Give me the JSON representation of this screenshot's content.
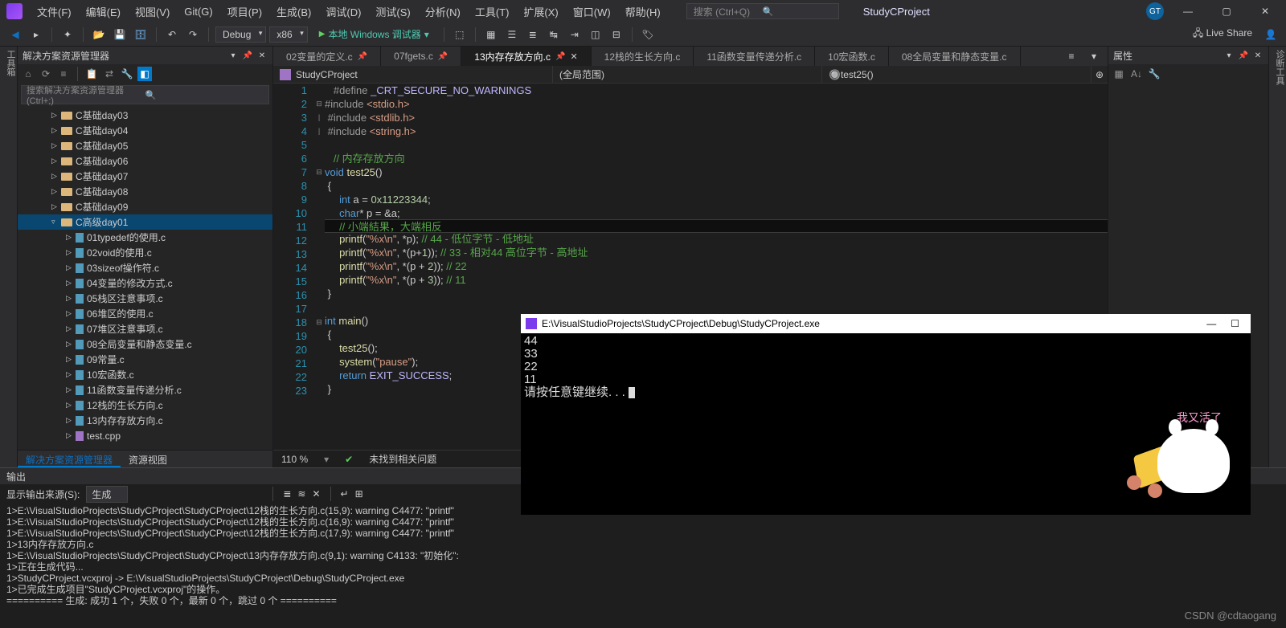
{
  "menubar": {
    "items": [
      "文件(F)",
      "编辑(E)",
      "视图(V)",
      "Git(G)",
      "项目(P)",
      "生成(B)",
      "调试(D)",
      "测试(S)",
      "分析(N)",
      "工具(T)",
      "扩展(X)",
      "窗口(W)",
      "帮助(H)"
    ],
    "search_placeholder": "搜索 (Ctrl+Q)",
    "project": "StudyCProject",
    "avatar": "GT"
  },
  "toolbar": {
    "config": "Debug",
    "platform": "x86",
    "run_label": "本地 Windows 调试器",
    "liveshare": "Live Share"
  },
  "solution": {
    "title": "解决方案资源管理器",
    "search_placeholder": "搜索解决方案资源管理器(Ctrl+;)",
    "tree": [
      {
        "indent": 2,
        "arrow": "▷",
        "icon": "folder",
        "label": "C基础day03"
      },
      {
        "indent": 2,
        "arrow": "▷",
        "icon": "folder",
        "label": "C基础day04"
      },
      {
        "indent": 2,
        "arrow": "▷",
        "icon": "folder",
        "label": "C基础day05"
      },
      {
        "indent": 2,
        "arrow": "▷",
        "icon": "folder",
        "label": "C基础day06"
      },
      {
        "indent": 2,
        "arrow": "▷",
        "icon": "folder",
        "label": "C基础day07"
      },
      {
        "indent": 2,
        "arrow": "▷",
        "icon": "folder",
        "label": "C基础day08"
      },
      {
        "indent": 2,
        "arrow": "▷",
        "icon": "folder",
        "label": "C基础day09"
      },
      {
        "indent": 2,
        "arrow": "▿",
        "icon": "folder",
        "label": "C高级day01",
        "selected": true
      },
      {
        "indent": 3,
        "arrow": "▷",
        "icon": "file",
        "label": "01typedef的使用.c"
      },
      {
        "indent": 3,
        "arrow": "▷",
        "icon": "file",
        "label": "02void的使用.c"
      },
      {
        "indent": 3,
        "arrow": "▷",
        "icon": "file",
        "label": "03sizeof操作符.c"
      },
      {
        "indent": 3,
        "arrow": "▷",
        "icon": "file",
        "label": "04变量的修改方式.c"
      },
      {
        "indent": 3,
        "arrow": "▷",
        "icon": "file",
        "label": "05栈区注意事项.c"
      },
      {
        "indent": 3,
        "arrow": "▷",
        "icon": "file",
        "label": "06堆区的使用.c"
      },
      {
        "indent": 3,
        "arrow": "▷",
        "icon": "file",
        "label": "07堆区注意事项.c"
      },
      {
        "indent": 3,
        "arrow": "▷",
        "icon": "file",
        "label": "08全局变量和静态变量.c"
      },
      {
        "indent": 3,
        "arrow": "▷",
        "icon": "file",
        "label": "09常量.c"
      },
      {
        "indent": 3,
        "arrow": "▷",
        "icon": "file",
        "label": "10宏函数.c"
      },
      {
        "indent": 3,
        "arrow": "▷",
        "icon": "file",
        "label": "11函数变量传递分析.c"
      },
      {
        "indent": 3,
        "arrow": "▷",
        "icon": "file",
        "label": "12栈的生长方向.c"
      },
      {
        "indent": 3,
        "arrow": "▷",
        "icon": "file",
        "label": "13内存存放方向.c"
      },
      {
        "indent": 3,
        "arrow": "▷",
        "icon": "cpp",
        "label": "test.cpp"
      }
    ],
    "bottom_tabs": [
      "解决方案资源管理器",
      "资源视图"
    ]
  },
  "editor": {
    "tabs": [
      {
        "label": "02变量的定义.c",
        "pin": true
      },
      {
        "label": "07fgets.c",
        "pin": true
      },
      {
        "label": "13内存存放方向.c",
        "pin": true,
        "active": true,
        "close": true
      },
      {
        "label": "12栈的生长方向.c"
      },
      {
        "label": "11函数变量传递分析.c"
      },
      {
        "label": "10宏函数.c"
      },
      {
        "label": "08全局变量和静态变量.c"
      }
    ],
    "nav": {
      "project": "StudyCProject",
      "scope": "(全局范围)",
      "member": "test25()"
    },
    "zoom": "110 %",
    "issues": "未找到相关问题"
  },
  "code_lines": [
    {
      "n": 1,
      "fold": "",
      "html": "   <span class='def'>#define</span> <span class='mac'>_CRT_SECURE_NO_WARNINGS</span>"
    },
    {
      "n": 2,
      "fold": "⊟",
      "html": "<span class='pp'>#include</span> <span class='inc'>&lt;stdio.h&gt;</span>"
    },
    {
      "n": 3,
      "fold": "|",
      "html": " <span class='pp'>#include</span> <span class='inc'>&lt;stdlib.h&gt;</span>"
    },
    {
      "n": 4,
      "fold": "|",
      "html": " <span class='pp'>#include</span> <span class='inc'>&lt;string.h&gt;</span>"
    },
    {
      "n": 5,
      "fold": "",
      "html": ""
    },
    {
      "n": 6,
      "fold": "",
      "html": "   <span class='com'>// 内存存放方向</span>"
    },
    {
      "n": 7,
      "fold": "⊟",
      "html": "<span class='kw'>void</span> <span class='fn'>test25</span>()"
    },
    {
      "n": 8,
      "fold": "",
      "html": " {"
    },
    {
      "n": 9,
      "fold": "",
      "html": "     <span class='kw'>int</span> a = <span class='num'>0x11223344</span>;"
    },
    {
      "n": 10,
      "fold": "",
      "html": "     <span class='kw'>char</span>* p = &amp;a;"
    },
    {
      "n": 11,
      "fold": "",
      "html": "     <span class='com'>// 小端結果，大端相反</span>",
      "current": true
    },
    {
      "n": 12,
      "fold": "",
      "html": "     <span class='fn'>printf</span>(<span class='str'>\"%x\\n\"</span>, *p); <span class='com'>// 44 - 低位字节 - 低地址</span>"
    },
    {
      "n": 13,
      "fold": "",
      "html": "     <span class='fn'>printf</span>(<span class='str'>\"%x\\n\"</span>, *(p+<span class='num'>1</span>)); <span class='com'>// 33 - 相对44 高位字节 - 高地址</span>"
    },
    {
      "n": 14,
      "fold": "",
      "html": "     <span class='fn'>printf</span>(<span class='str'>\"%x\\n\"</span>, *(p + <span class='num'>2</span>)); <span class='com'>// 22</span>"
    },
    {
      "n": 15,
      "fold": "",
      "html": "     <span class='fn'>printf</span>(<span class='str'>\"%x\\n\"</span>, *(p + <span class='num'>3</span>)); <span class='com'>// 11</span>"
    },
    {
      "n": 16,
      "fold": "",
      "html": " }"
    },
    {
      "n": 17,
      "fold": "",
      "html": ""
    },
    {
      "n": 18,
      "fold": "⊟",
      "html": "<span class='kw'>int</span> <span class='fn'>main</span>()"
    },
    {
      "n": 19,
      "fold": "",
      "html": " {"
    },
    {
      "n": 20,
      "fold": "",
      "html": "     <span class='fn'>test25</span>();"
    },
    {
      "n": 21,
      "fold": "",
      "html": "     <span class='fn'>system</span>(<span class='str'>\"pause\"</span>);"
    },
    {
      "n": 22,
      "fold": "",
      "html": "     <span class='kw'>return</span> <span class='mac'>EXIT_SUCCESS</span>;"
    },
    {
      "n": 23,
      "fold": "",
      "html": " }"
    }
  ],
  "properties": {
    "title": "属性"
  },
  "output": {
    "title": "输出",
    "source_label": "显示输出来源(S):",
    "source_value": "生成",
    "lines": [
      "1>E:\\VisualStudioProjects\\StudyCProject\\StudyCProject\\12栈的生长方向.c(15,9): warning C4477: \"printf\"",
      "1>E:\\VisualStudioProjects\\StudyCProject\\StudyCProject\\12栈的生长方向.c(16,9): warning C4477: \"printf\"",
      "1>E:\\VisualStudioProjects\\StudyCProject\\StudyCProject\\12栈的生长方向.c(17,9): warning C4477: \"printf\"",
      "1>13内存存放方向.c",
      "1>E:\\VisualStudioProjects\\StudyCProject\\StudyCProject\\13内存存放方向.c(9,1): warning C4133: \"初始化\":",
      "1>正在生成代码...",
      "1>StudyCProject.vcxproj -> E:\\VisualStudioProjects\\StudyCProject\\Debug\\StudyCProject.exe",
      "1>已完成生成项目\"StudyCProject.vcxproj\"的操作。",
      "========== 生成: 成功 1 个，失败 0 个，最新 0 个，跳过 0 个 =========="
    ]
  },
  "console": {
    "title": "E:\\VisualStudioProjects\\StudyCProject\\Debug\\StudyCProject.exe",
    "lines": [
      "44",
      "33",
      "22",
      "11",
      "请按任意键继续. . . "
    ]
  },
  "mascot_text": "我又活了",
  "watermark": "CSDN @cdtaogang",
  "sidebars": {
    "left": "工具箱",
    "right": "诊断工具"
  }
}
